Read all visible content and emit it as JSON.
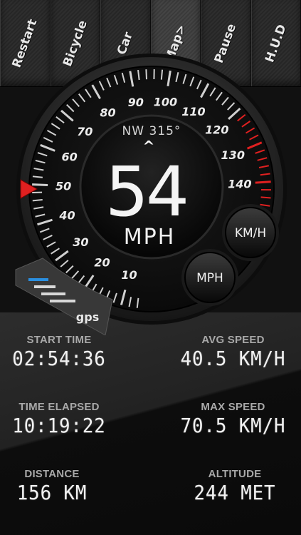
{
  "toolbar": {
    "buttons": [
      {
        "label": "Restart"
      },
      {
        "label": "Bicycle"
      },
      {
        "label": "Car"
      },
      {
        "label": "Map>"
      },
      {
        "label": "Pause"
      },
      {
        "label": "H.U.D"
      }
    ]
  },
  "gauge": {
    "heading": "NW 315°",
    "heading_caret": "^",
    "speed": "54",
    "unit": "MPH",
    "dial_labels": [
      "10",
      "20",
      "30",
      "40",
      "50",
      "60",
      "70",
      "80",
      "90",
      "100",
      "110",
      "120",
      "130",
      "140"
    ],
    "gps_label": "gps",
    "colors": {
      "accent_red": "#e02020",
      "gps_blue": "#2a8fe0"
    }
  },
  "unit_buttons": {
    "kmh": "KM/H",
    "mph": "MPH"
  },
  "stats": {
    "start_time": {
      "label": "START TIME",
      "value": "02:54:36"
    },
    "avg_speed": {
      "label": "AVG SPEED",
      "value": "40.5 KM/H"
    },
    "time_elapsed": {
      "label": "TIME ELAPSED",
      "value": "10:19:22"
    },
    "max_speed": {
      "label": "MAX SPEED",
      "value": "70.5 KM/H"
    },
    "distance": {
      "label": "DISTANCE",
      "value": "156 KM"
    },
    "altitude": {
      "label": "ALTITUDE",
      "value": "244 MET"
    }
  }
}
